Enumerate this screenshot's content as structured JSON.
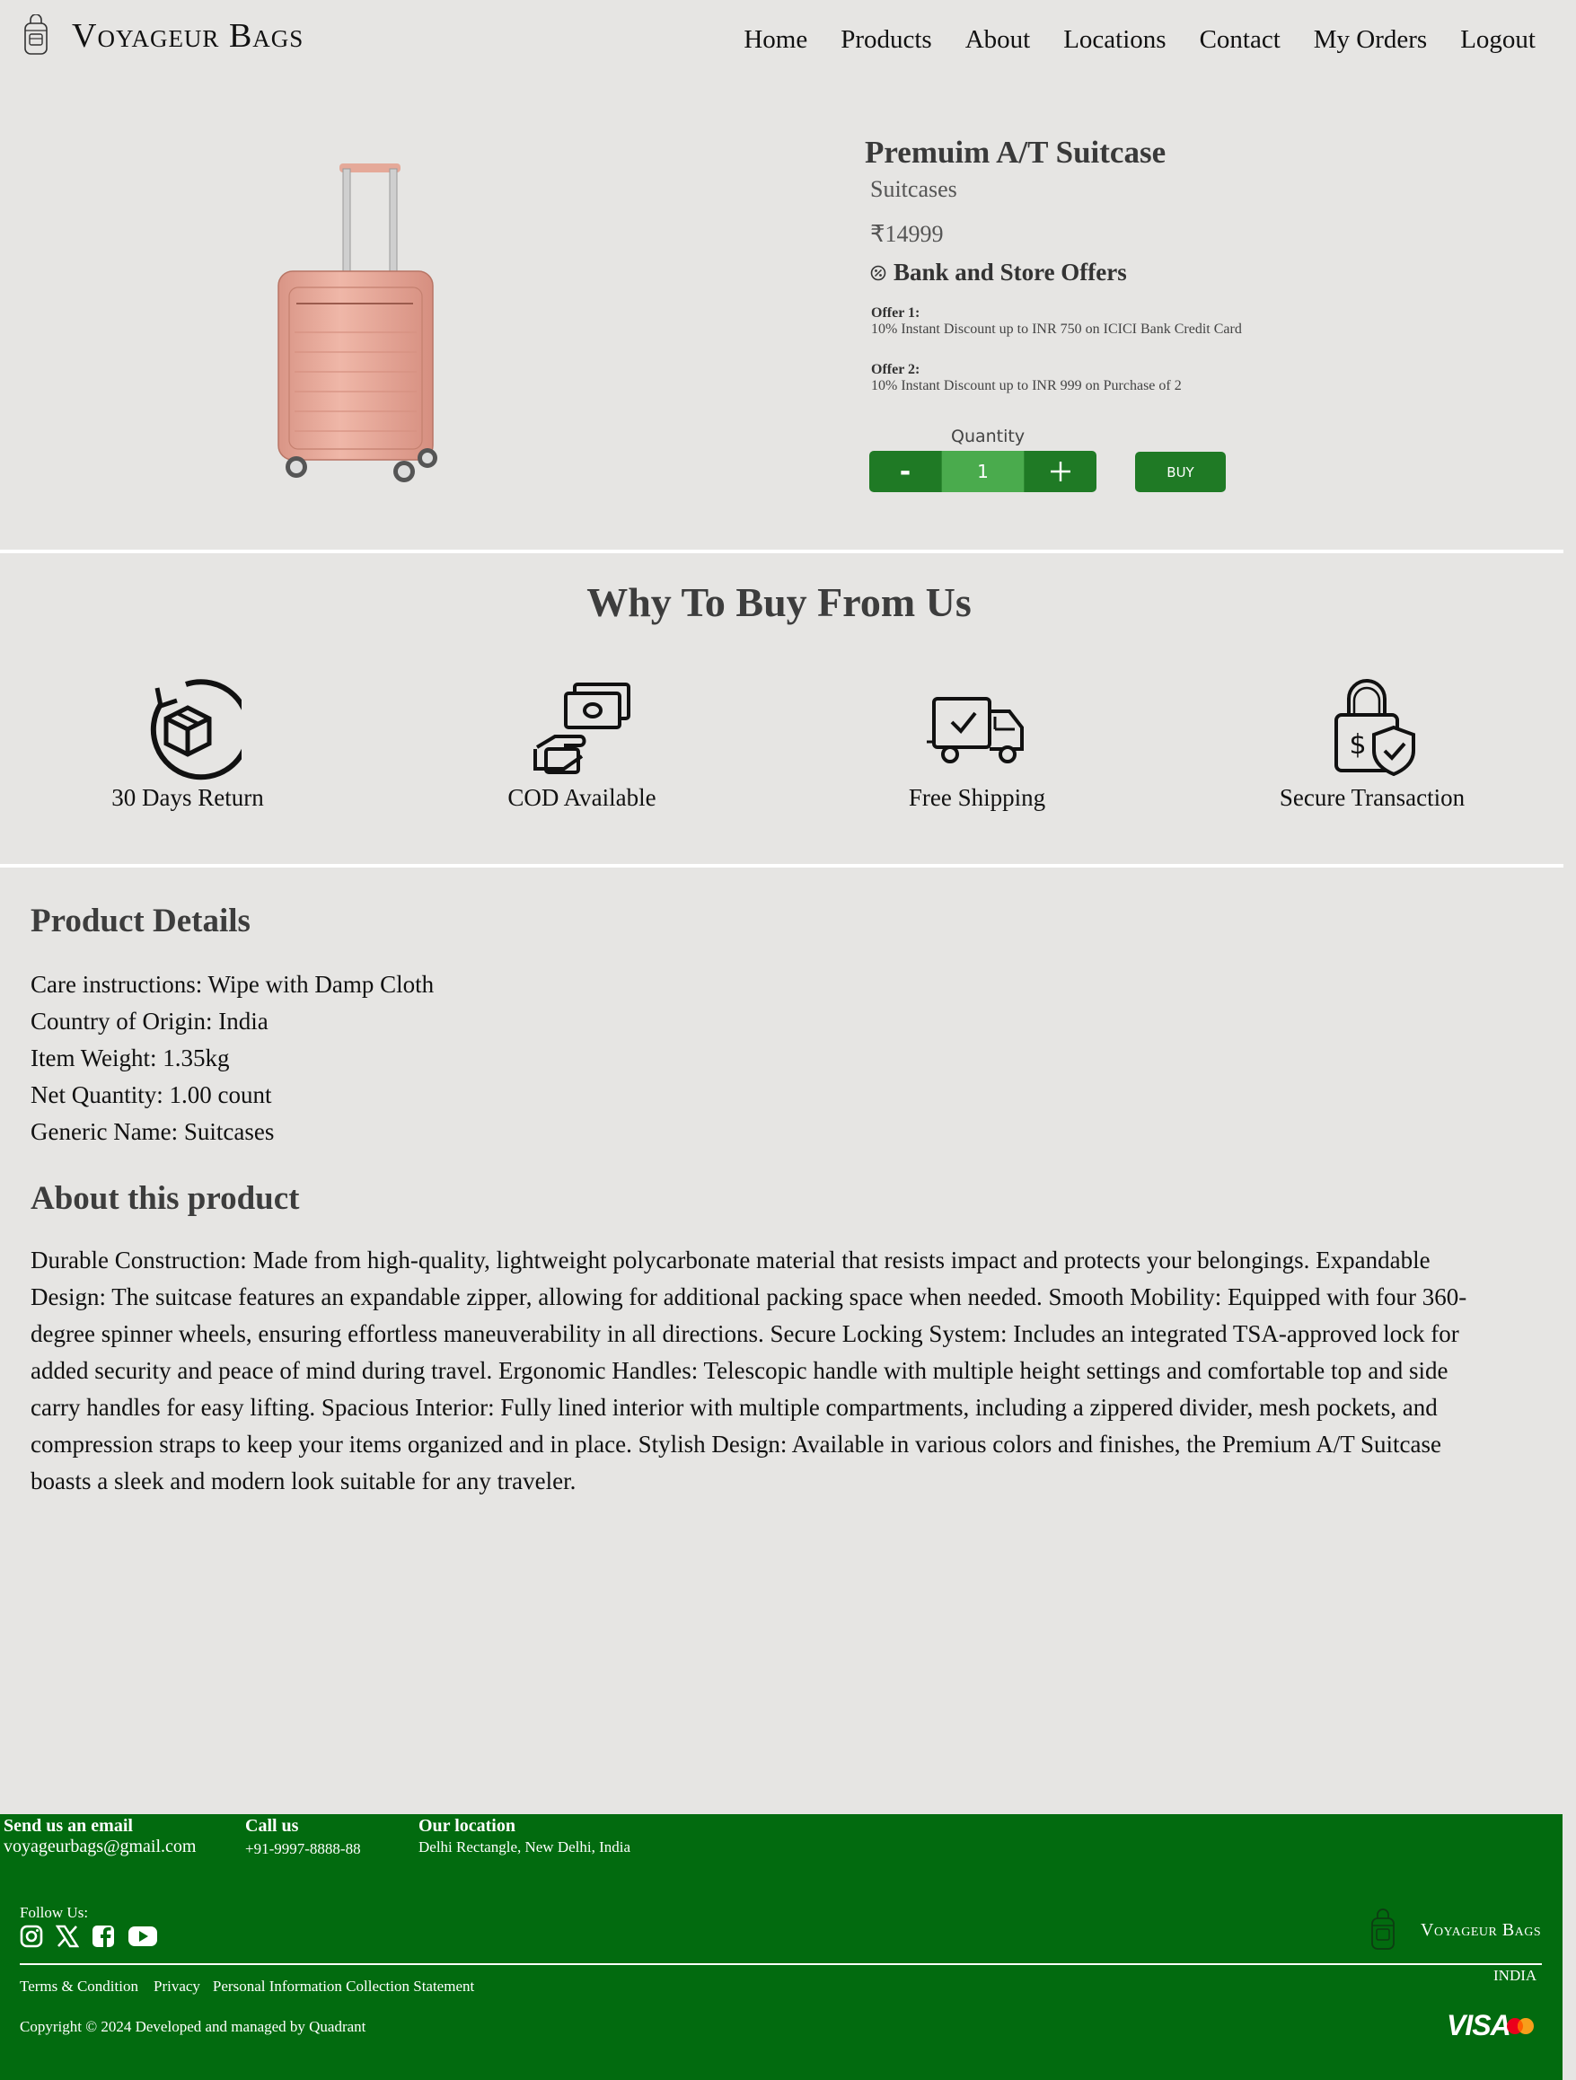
{
  "brand": {
    "name": "Voyageur Bags"
  },
  "nav": {
    "items": [
      "Home",
      "Products",
      "About",
      "Locations",
      "Contact",
      "My Orders",
      "Logout"
    ]
  },
  "product": {
    "title": "Premuim A/T Suitcase",
    "category": "Suitcases",
    "price": "₹14999",
    "offers_heading": "Bank and Store Offers",
    "offers": [
      {
        "label": "Offer 1:",
        "text": "10% Instant Discount up to INR 750 on ICICI Bank Credit Card"
      },
      {
        "label": "Offer 2:",
        "text": "10% Instant Discount up to INR 999 on Purchase of 2"
      }
    ],
    "quantity_label": "Quantity",
    "quantity_value": "1",
    "minus_label": "-",
    "plus_label": "+",
    "buy_label": "BUY"
  },
  "why": {
    "heading": "Why To Buy From Us",
    "features": [
      {
        "label": "30 Days Return",
        "icon": "box-return-icon"
      },
      {
        "label": "COD Available",
        "icon": "cash-hand-icon"
      },
      {
        "label": "Free Shipping",
        "icon": "delivery-truck-icon"
      },
      {
        "label": "Secure Transaction",
        "icon": "lock-shield-icon"
      }
    ]
  },
  "details": {
    "heading": "Product Details",
    "items": [
      "Care instructions: Wipe with Damp Cloth",
      "Country of Origin: India",
      "Item Weight: 1.35kg",
      "Net Quantity: 1.00 count",
      "Generic Name: Suitcases"
    ]
  },
  "about": {
    "heading": "About this product",
    "text": "Durable Construction: Made from high-quality, lightweight polycarbonate material that resists impact and protects your belongings. Expandable Design: The suitcase features an expandable zipper, allowing for additional packing space when needed. Smooth Mobility: Equipped with four 360-degree spinner wheels, ensuring effortless maneuverability in all directions. Secure Locking System: Includes an integrated TSA-approved lock for added security and peace of mind during travel. Ergonomic Handles: Telescopic handle with multiple height settings and comfortable top and side carry handles for easy lifting. Spacious Interior: Fully lined interior with multiple compartments, including a zippered divider, mesh pockets, and compression straps to keep your items organized and in place. Stylish Design: Available in various colors and finishes, the Premium A/T Suitcase boasts a sleek and modern look suitable for any traveler."
  },
  "footer": {
    "email_heading": "Send us an email",
    "email": "voyageurbags@gmail.com",
    "call_heading": "Call us",
    "phone": "+91-9997-8888-88",
    "location_heading": "Our location",
    "location": "Delhi Rectangle, New Delhi, India",
    "follow": "Follow Us:",
    "brand": "Voyageur Bags",
    "country": "INDIA",
    "links": [
      "Terms & Condition",
      "Privacy",
      "Personal Information Collection Statement"
    ],
    "copyright": "Copyright © 2024 Developed and managed by Quadrant",
    "visa": "VISA",
    "socials": [
      "instagram-icon",
      "x-icon",
      "facebook-icon",
      "youtube-icon"
    ]
  },
  "colors": {
    "green": "#1f7a25",
    "footer_green": "#026b0f",
    "background": "#e6e5e3",
    "suitcase": "#e8a898"
  }
}
